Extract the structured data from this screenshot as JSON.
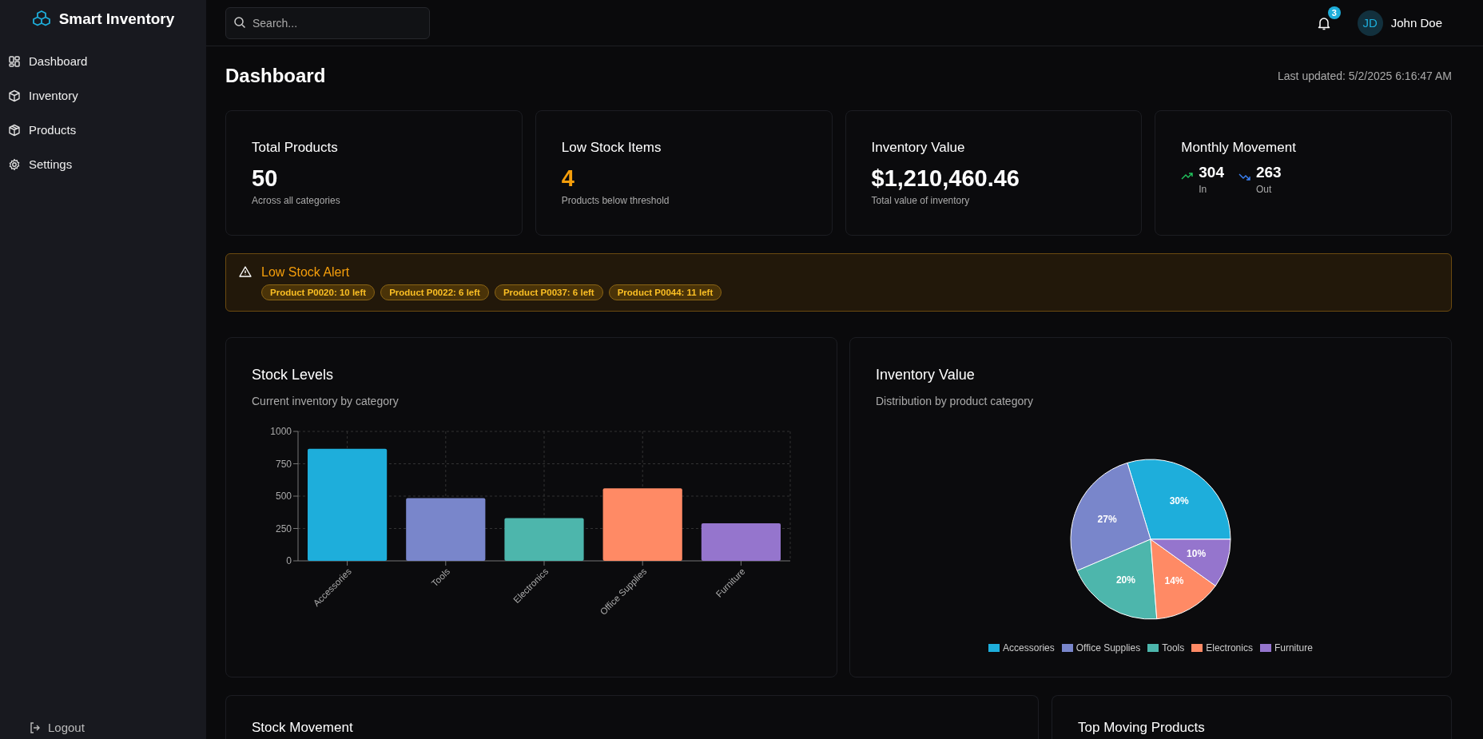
{
  "sidebar": {
    "logo": "Smart Inventory",
    "items": [
      {
        "label": "Dashboard"
      },
      {
        "label": "Inventory"
      },
      {
        "label": "Products"
      },
      {
        "label": "Settings"
      }
    ],
    "logout": "Logout"
  },
  "header": {
    "search": {
      "placeholder": "Search..."
    },
    "notifications": {
      "count": "3"
    },
    "user": {
      "initials": "JD",
      "name": "John Doe"
    }
  },
  "page": {
    "title": "Dashboard",
    "last_updated": "Last updated: 5/2/2025 6:16:47 AM"
  },
  "stats": [
    {
      "kind": "value",
      "title": "Total Products",
      "value": "50",
      "caption": "Across all categories",
      "warning": false
    },
    {
      "kind": "value",
      "title": "Low Stock Items",
      "value": "4",
      "caption": "Products below threshold",
      "warning": true
    },
    {
      "kind": "value",
      "title": "Inventory Value",
      "value": "$1,210,460.46",
      "caption": "Total value of inventory",
      "warning": false
    },
    {
      "kind": "movement",
      "title": "Monthly Movement",
      "in": {
        "value": "304",
        "label": "In"
      },
      "out": {
        "value": "263",
        "label": "Out"
      }
    }
  ],
  "alert": {
    "title": "Low Stock Alert",
    "items": [
      "Product P0020: 10 left",
      "Product P0022: 6 left",
      "Product P0037: 6 left",
      "Product P0044: 11 left"
    ]
  },
  "charts": [
    {
      "title": "Stock Levels",
      "subtitle": "Current inventory by category",
      "chart_data": {
        "type": "bar",
        "grid": true,
        "categories": [
          "Accessories",
          "Tools",
          "Electronics",
          "Office Supplies",
          "Furniture"
        ],
        "ylim": [
          0,
          1000
        ],
        "yticks": [
          0,
          250,
          500,
          750,
          1000
        ],
        "values": [
          865,
          485,
          330,
          560,
          290
        ],
        "colors": [
          "#1eaedb",
          "#7986cb",
          "#4db6ac",
          "#ff8a65",
          "#9575cd"
        ]
      }
    },
    {
      "title": "Inventory Value",
      "subtitle": "Distribution by product category",
      "chart_data": {
        "type": "pie",
        "categories": [
          "Accessories",
          "Office Supplies",
          "Tools",
          "Electronics",
          "Furniture"
        ],
        "values": [
          30,
          27,
          20,
          14,
          10
        ],
        "value_labels": [
          "30%",
          "27%",
          "20%",
          "14%",
          "10%"
        ],
        "colors": [
          "#1eaedb",
          "#7986cb",
          "#4db6ac",
          "#ff8a65",
          "#9575cd"
        ]
      }
    }
  ],
  "bottom_cards": [
    {
      "title": "Stock Movement"
    },
    {
      "title": "Top Moving Products"
    }
  ]
}
